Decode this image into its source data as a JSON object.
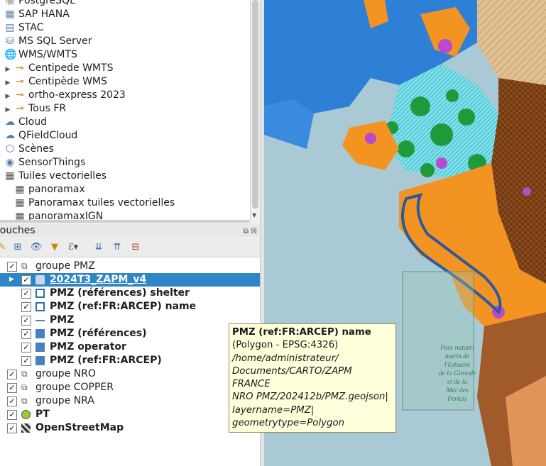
{
  "browser": {
    "items": [
      {
        "label": "PostgreSQL",
        "icon": "postgresql-icon",
        "indent": 0,
        "arrow": false
      },
      {
        "label": "SAP HANA",
        "icon": "sap-hana-icon",
        "indent": 0,
        "arrow": false
      },
      {
        "label": "STAC",
        "icon": "stac-icon",
        "indent": 0,
        "arrow": false
      },
      {
        "label": "MS SQL Server",
        "icon": "mssql-icon",
        "indent": 0,
        "arrow": false
      },
      {
        "label": "WMS/WMTS",
        "icon": "globe-icon",
        "indent": 0,
        "arrow": false
      },
      {
        "label": "Centipede WMTS",
        "icon": "wms-connection-icon",
        "indent": 1,
        "arrow": true
      },
      {
        "label": "Centipède WMS",
        "icon": "wms-connection-icon",
        "indent": 1,
        "arrow": true
      },
      {
        "label": "ortho-express 2023",
        "icon": "wms-connection-icon",
        "indent": 1,
        "arrow": true
      },
      {
        "label": "Tous FR",
        "icon": "wms-connection-icon",
        "indent": 1,
        "arrow": true
      },
      {
        "label": "Cloud",
        "icon": "cloud-icon",
        "indent": 0,
        "arrow": false
      },
      {
        "label": "QFieldCloud",
        "icon": "cloud-icon",
        "indent": 0,
        "arrow": false
      },
      {
        "label": "Scènes",
        "icon": "cube-icon",
        "indent": 0,
        "arrow": false
      },
      {
        "label": "SensorThings",
        "icon": "sensor-icon",
        "indent": 0,
        "arrow": false
      },
      {
        "label": "Tuiles vectorielles",
        "icon": "vector-tiles-icon",
        "indent": 0,
        "arrow": false
      },
      {
        "label": "panoramax",
        "icon": "vector-tiles-icon",
        "indent": 1,
        "arrow": false
      },
      {
        "label": "Panoramax tuiles vectorielles",
        "icon": "vector-tiles-icon",
        "indent": 1,
        "arrow": false
      },
      {
        "label": "panoramaxIGN",
        "icon": "vector-tiles-icon",
        "indent": 1,
        "arrow": false
      }
    ]
  },
  "layers_panel": {
    "title": "Couches",
    "rows": [
      {
        "label": "groupe PMZ",
        "type": "group",
        "indent": 0,
        "checked": true,
        "bold": false,
        "selected": false
      },
      {
        "label": "2024T3_ZAPM_v4",
        "type": "layer",
        "indent": 1,
        "checked": true,
        "bold": true,
        "selected": true
      },
      {
        "label": "PMZ (références) shelter",
        "type": "outline",
        "indent": 1,
        "checked": true,
        "bold": true,
        "selected": false
      },
      {
        "label": "PMZ (ref:FR:ARCEP) name",
        "type": "outline",
        "indent": 1,
        "checked": true,
        "bold": true,
        "selected": false
      },
      {
        "label": "PMZ",
        "type": "line",
        "indent": 1,
        "checked": true,
        "bold": true,
        "selected": false
      },
      {
        "label": "PMZ (références)",
        "type": "fill",
        "indent": 1,
        "checked": true,
        "bold": true,
        "selected": false
      },
      {
        "label": "PMZ operator",
        "type": "fill",
        "indent": 1,
        "checked": true,
        "bold": true,
        "selected": false
      },
      {
        "label": "PMZ (ref:FR:ARCEP)",
        "type": "fill",
        "indent": 1,
        "checked": true,
        "bold": true,
        "selected": false
      },
      {
        "label": "groupe NRO",
        "type": "group",
        "indent": 0,
        "checked": true,
        "bold": false,
        "selected": false
      },
      {
        "label": "groupe COPPER",
        "type": "group",
        "indent": 0,
        "checked": true,
        "bold": false,
        "selected": false
      },
      {
        "label": "groupe NRA",
        "type": "group",
        "indent": 0,
        "checked": true,
        "bold": false,
        "selected": false
      },
      {
        "label": "PT",
        "type": "point",
        "indent": 0,
        "checked": true,
        "bold": true,
        "selected": false
      },
      {
        "label": "OpenStreetMap",
        "type": "raster",
        "indent": 0,
        "checked": true,
        "bold": true,
        "selected": false
      }
    ]
  },
  "tooltip": {
    "title": "PMZ (ref:FR:ARCEP) name",
    "line1": "(Polygon - EPSG:4326)",
    "line2": "/home/administrateur/",
    "line3": "Documents/CARTO/ZAPM FRANCE",
    "line4": "NRO PMZ/202412b/PMZ.geojson|",
    "line5": "layername=PMZ|",
    "line6": "geometrytype=Polygon"
  },
  "map": {
    "park_label_1": "Parc naturel",
    "park_label_2": "marin de",
    "park_label_3": "l'Estuaire",
    "park_label_4": "de la Gironde",
    "park_label_5": "et de la",
    "park_label_6": "Mer des",
    "park_label_7": "Pertuis",
    "colors": {
      "sea": "#a9c9d4",
      "land_orange": "#f39322",
      "blue": "#2e7fd6",
      "green": "#1f9a3a",
      "brown": "#8a4a1a",
      "purple": "#b84ad0",
      "cyan": "#7fe0ea"
    }
  }
}
